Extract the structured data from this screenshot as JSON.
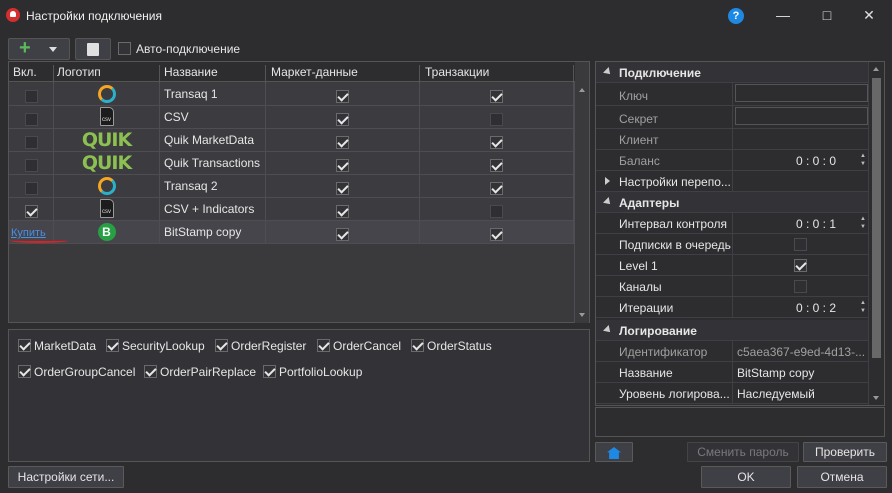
{
  "window": {
    "title": "Настройки подключения"
  },
  "toolbar": {
    "auto_connect_label": "Авто-подключение",
    "auto_connect_checked": false
  },
  "grid": {
    "columns": [
      "Вкл.",
      "Логотип",
      "Название",
      "Маркет-данные",
      "Транзакции"
    ],
    "rows": [
      {
        "enabled": false,
        "logo": "transaq-logo-icon",
        "name": "Transaq 1",
        "market_data": true,
        "transactions": true
      },
      {
        "enabled": false,
        "logo": "csv-file-icon",
        "name": "CSV",
        "market_data": true,
        "transactions": false
      },
      {
        "enabled": false,
        "logo": "quik-logo-icon",
        "logo_text": "QUIK",
        "name": "Quik MarketData",
        "market_data": true,
        "transactions": true
      },
      {
        "enabled": false,
        "logo": "quik-logo-icon",
        "logo_text": "QUIK",
        "name": "Quik Transactions",
        "market_data": true,
        "transactions": true
      },
      {
        "enabled": false,
        "logo": "transaq-logo-icon",
        "name": "Transaq 2",
        "market_data": true,
        "transactions": true
      },
      {
        "enabled": true,
        "logo": "csv-file-icon",
        "name": "CSV + Indicators",
        "market_data": true,
        "transactions": false
      },
      {
        "buy_link": "Купить",
        "logo": "bitstamp-logo-icon",
        "logo_text": "B",
        "name": "BitStamp copy",
        "market_data": true,
        "transactions": true
      }
    ]
  },
  "messages": [
    {
      "label": "MarketData",
      "checked": true
    },
    {
      "label": "SecurityLookup",
      "checked": true
    },
    {
      "label": "OrderRegister",
      "checked": true
    },
    {
      "label": "OrderCancel",
      "checked": true
    },
    {
      "label": "OrderStatus",
      "checked": true
    },
    {
      "label": "OrderGroupCancel",
      "checked": true
    },
    {
      "label": "OrderPairReplace",
      "checked": true
    },
    {
      "label": "PortfolioLookup",
      "checked": true
    }
  ],
  "properties": {
    "connection": {
      "title": "Подключение",
      "key_label": "Ключ",
      "secret_label": "Секрет",
      "client_label": "Клиент",
      "balance_label": "Баланс",
      "balance_value": "0 : 0 : 0",
      "reconnect_label": "Настройки перепо..."
    },
    "adapters": {
      "title": "Адаптеры",
      "interval_label": "Интервал контроля",
      "interval_value": "0 : 0 : 1",
      "queue_label": "Подписки в очередь",
      "queue_checked": false,
      "level1_label": "Level 1",
      "level1_checked": true,
      "channels_label": "Каналы",
      "channels_checked": false,
      "iterations_label": "Итерации",
      "iterations_value": "0 : 0 : 2"
    },
    "logging": {
      "title": "Логирование",
      "id_label": "Идентификатор",
      "id_value": "c5aea367-e9ed-4d13-...",
      "name_label": "Название",
      "name_value": "BitStamp copy",
      "level_label": "Уровень логирова...",
      "level_value": "Наследуемый"
    }
  },
  "buttons": {
    "change_password": "Сменить пароль",
    "check": "Проверить",
    "network_settings": "Настройки сети...",
    "ok": "OK",
    "cancel": "Отмена"
  },
  "colors": {
    "accent": "#1e88e5",
    "link": "#4a90e2",
    "quik_green": "#8cc152",
    "bitstamp_green": "#27a044"
  }
}
